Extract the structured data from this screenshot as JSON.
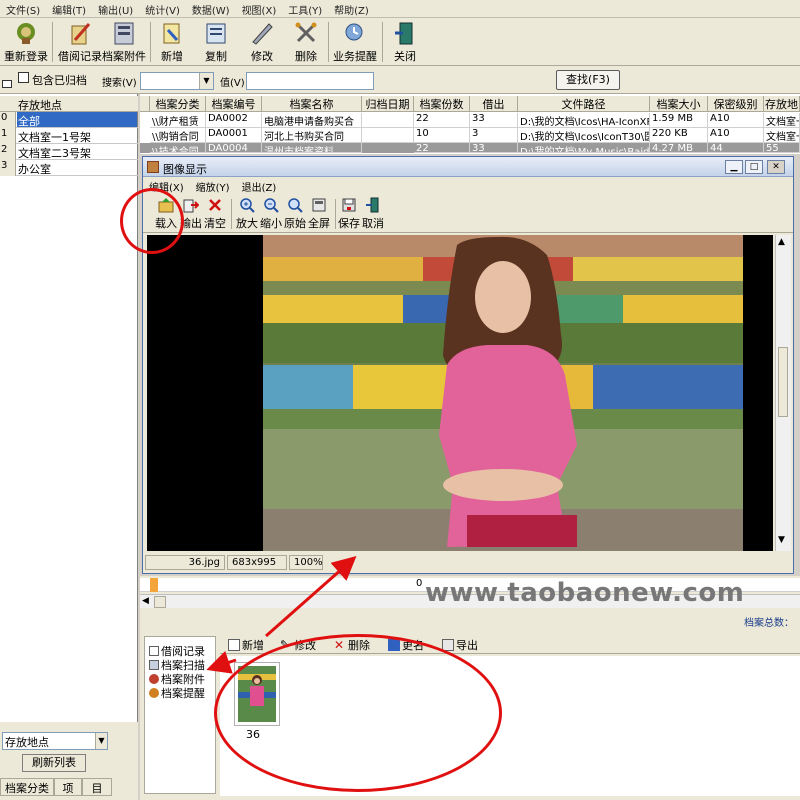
{
  "menubar": [
    "文件(S)",
    "编辑(T)",
    "输出(U)",
    "统计(V)",
    "数据(W)",
    "视图(X)",
    "工具(Y)",
    "帮助(Z)"
  ],
  "toolbar": {
    "buttons": [
      {
        "label": "重新登录",
        "icon": "relogin-icon"
      },
      {
        "label": "借阅记录",
        "icon": "borrow-record-icon"
      },
      {
        "label": "档案附件",
        "icon": "attachment-icon"
      },
      {
        "label": "新增",
        "icon": "new-icon"
      },
      {
        "label": "复制",
        "icon": "copy-icon"
      },
      {
        "label": "修改",
        "icon": "edit-icon"
      },
      {
        "label": "删除",
        "icon": "delete-icon"
      },
      {
        "label": "业务提醒",
        "icon": "reminder-icon"
      },
      {
        "label": "关闭",
        "icon": "close-door-icon"
      }
    ]
  },
  "search": {
    "include_archived": "包含已归档",
    "search_label": "搜索(V)",
    "value_label": "值(V)",
    "search_button": "查找(F3)"
  },
  "left_panel": {
    "header": "存放地点",
    "rows": [
      {
        "num": "0",
        "text": "全部",
        "selected": true
      },
      {
        "num": "1",
        "text": "文档室一1号架",
        "selected": false
      },
      {
        "num": "2",
        "text": "文档室二3号架",
        "selected": false
      },
      {
        "num": "3",
        "text": "办公室",
        "selected": false
      }
    ],
    "select_value": "存放地点",
    "refresh_button": "刷新列表",
    "tabs": [
      "档案分类",
      "项",
      "目"
    ]
  },
  "grid": {
    "headers": [
      "档案分类",
      "档案编号",
      "档案名称",
      "归档日期",
      "档案份数",
      "借出",
      "文件路径",
      "档案大小",
      "保密级别",
      "存放地"
    ],
    "rows": [
      [
        "\\\\财产租赁",
        "DA0002",
        "电脑港申请备购买合",
        "",
        "22",
        "33",
        "D:\\我的文档\\Icos\\HA-IconXP",
        "1.59 MB",
        "A10",
        "文档室一"
      ],
      [
        "\\\\购销合同",
        "DA0001",
        "河北上书购买合同",
        "",
        "10",
        "3",
        "D:\\我的文档\\Icos\\IconT30\\医",
        "220 KB",
        "A10",
        "文档室一"
      ],
      [
        "\\\\技术合同",
        "DA0004",
        "温州市档案资料",
        "",
        "22",
        "33",
        "D:\\我的文档\\My Music\\Baidu",
        "4.27 MB",
        "44",
        "55"
      ]
    ]
  },
  "image_window": {
    "title": "图像显示",
    "menu": [
      "编辑(X)",
      "缩放(Y)",
      "退出(Z)"
    ],
    "tools": [
      {
        "label": "载入",
        "icon": "load-icon"
      },
      {
        "label": "输出",
        "icon": "export-icon"
      },
      {
        "label": "清空",
        "icon": "clear-icon"
      },
      {
        "label": "放大",
        "icon": "zoom-in-icon"
      },
      {
        "label": "缩小",
        "icon": "zoom-out-icon"
      },
      {
        "label": "原始",
        "icon": "original-size-icon"
      },
      {
        "label": "全屏",
        "icon": "fullscreen-icon"
      },
      {
        "label": "保存",
        "icon": "save-icon"
      },
      {
        "label": "取消",
        "icon": "cancel-icon"
      }
    ],
    "status": {
      "file": "36.jpg",
      "dims": "683x995",
      "zoom": "100%"
    }
  },
  "bottom": {
    "summary_label": "档案总数：",
    "tree": [
      "借阅记录",
      "档案扫描",
      "档案附件",
      "档案提醒"
    ],
    "thumb_tools": [
      "新增",
      "修改",
      "删除",
      "更名",
      "导出"
    ],
    "thumbnail_label": "36",
    "row_fragment": "0",
    "watermark": "www.taobaonew.com"
  },
  "colors": {
    "accent": "#316ac5",
    "annotation": "#e01010"
  }
}
